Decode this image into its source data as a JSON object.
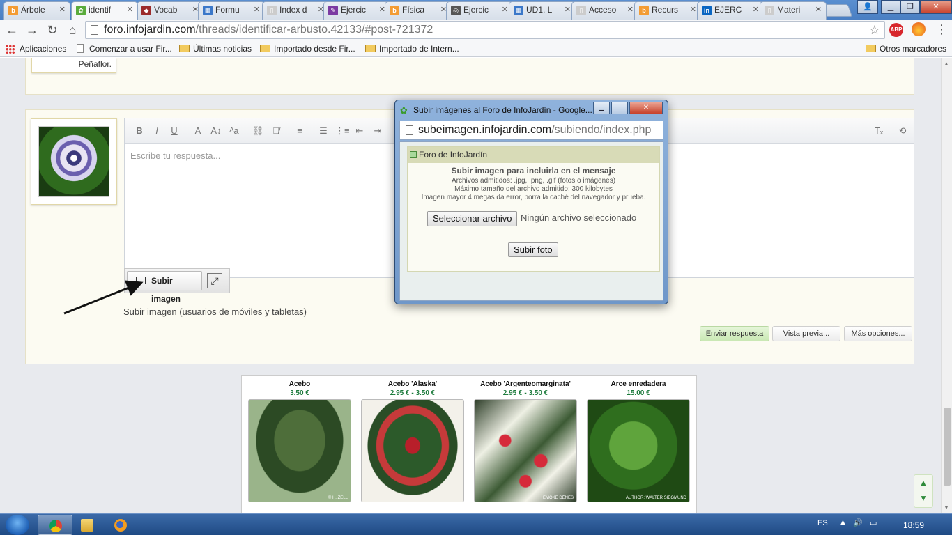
{
  "browser": {
    "tabs": [
      {
        "label": "Árbole",
        "color": "#f39c34",
        "fav": "b"
      },
      {
        "label": "identif",
        "color": "#5aab3c",
        "fav": "✿",
        "active": true
      },
      {
        "label": "Vocab",
        "color": "#9c2b2b",
        "fav": "◆"
      },
      {
        "label": "Formu",
        "color": "#3b78c9",
        "fav": "▦"
      },
      {
        "label": "Index d",
        "color": "#cccccc",
        "fav": "▯"
      },
      {
        "label": "Ejercic",
        "color": "#7b3aa2",
        "fav": "✎"
      },
      {
        "label": "Física",
        "color": "#f39c34",
        "fav": "b"
      },
      {
        "label": "Ejercic",
        "color": "#555555",
        "fav": "◎"
      },
      {
        "label": "UD1. L",
        "color": "#3b78c9",
        "fav": "▦"
      },
      {
        "label": "Acceso",
        "color": "#cccccc",
        "fav": "▯"
      },
      {
        "label": "Recurs",
        "color": "#f39c34",
        "fav": "b"
      },
      {
        "label": "EJERCI",
        "color": "#0a66c2",
        "fav": "in"
      },
      {
        "label": "Materi",
        "color": "#cccccc",
        "fav": "▯"
      }
    ],
    "url_host": "foro.infojardin.com",
    "url_path": "/threads/identificar-arbusto.42133/#post-721372",
    "adblock_label": "ABP",
    "bookmarks": [
      {
        "label": "Aplicaciones",
        "icon": "apps-icon"
      },
      {
        "label": "Comenzar a usar Fir...",
        "icon": "page-icon"
      },
      {
        "label": "Últimas noticias",
        "icon": "folder-icon"
      },
      {
        "label": "Importado desde Fir...",
        "icon": "folder-icon"
      },
      {
        "label": "Importado de Intern...",
        "icon": "folder-icon"
      }
    ],
    "other_bookmarks": "Otros marcadores"
  },
  "forum": {
    "prev_post_location": "Peñaflor.",
    "editor_placeholder": "Escribe tu respuesta...",
    "toolbar_icons": [
      "B",
      "I",
      "U",
      "A",
      "A↕",
      "ᴬa",
      "⛓",
      "⛓̸",
      "≡",
      "☰",
      "⋮≡",
      "⇤",
      "⇥"
    ],
    "upload_button": "Subir imagen",
    "mobile_upload_link": "Subir imagen (usuarios de móviles y tabletas)",
    "actions": {
      "send": "Enviar respuesta",
      "preview": "Vista previa...",
      "more": "Más opciones..."
    }
  },
  "ad": {
    "products": [
      {
        "name": "Acebo",
        "price": "3.50 €",
        "credit": "© H. ZELL"
      },
      {
        "name": "Acebo 'Alaska'",
        "price": "2.95 € - 3.50 €",
        "credit": ""
      },
      {
        "name": "Acebo 'Argenteomarginata'",
        "price": "2.95 € - 3.50 €",
        "credit": "EMÖKE DÉNES"
      },
      {
        "name": "Arce enredadera",
        "price": "15.00 €",
        "credit": "AUTHOR: WALTER SIEGMUND"
      }
    ]
  },
  "popup": {
    "title": "Subir imágenes al Foro de InfoJardín - Google...",
    "url_host": "subeimagen.infojardin.com",
    "url_path": "/subiendo/index.php",
    "header": "Foro de InfoJardín",
    "heading": "Subir imagen para incluirla en el mensaje",
    "info_lines": [
      "Archivos admitidos: .jpg, .png, .gif (fotos o imágenes)",
      "Máximo tamaño del archivo admitido: 300 kilobytes",
      "Imagen mayor 4 megas da error, borra la caché del navegador y prueba."
    ],
    "choose_file": "Seleccionar archivo",
    "no_file": "Ningún archivo seleccionado",
    "submit": "Subir foto"
  },
  "taskbar": {
    "language": "ES",
    "clock": "18:59"
  },
  "colors": {
    "arrow_red": "#e02020",
    "arrow_black": "#111111",
    "price_green": "#1b7a3b"
  }
}
